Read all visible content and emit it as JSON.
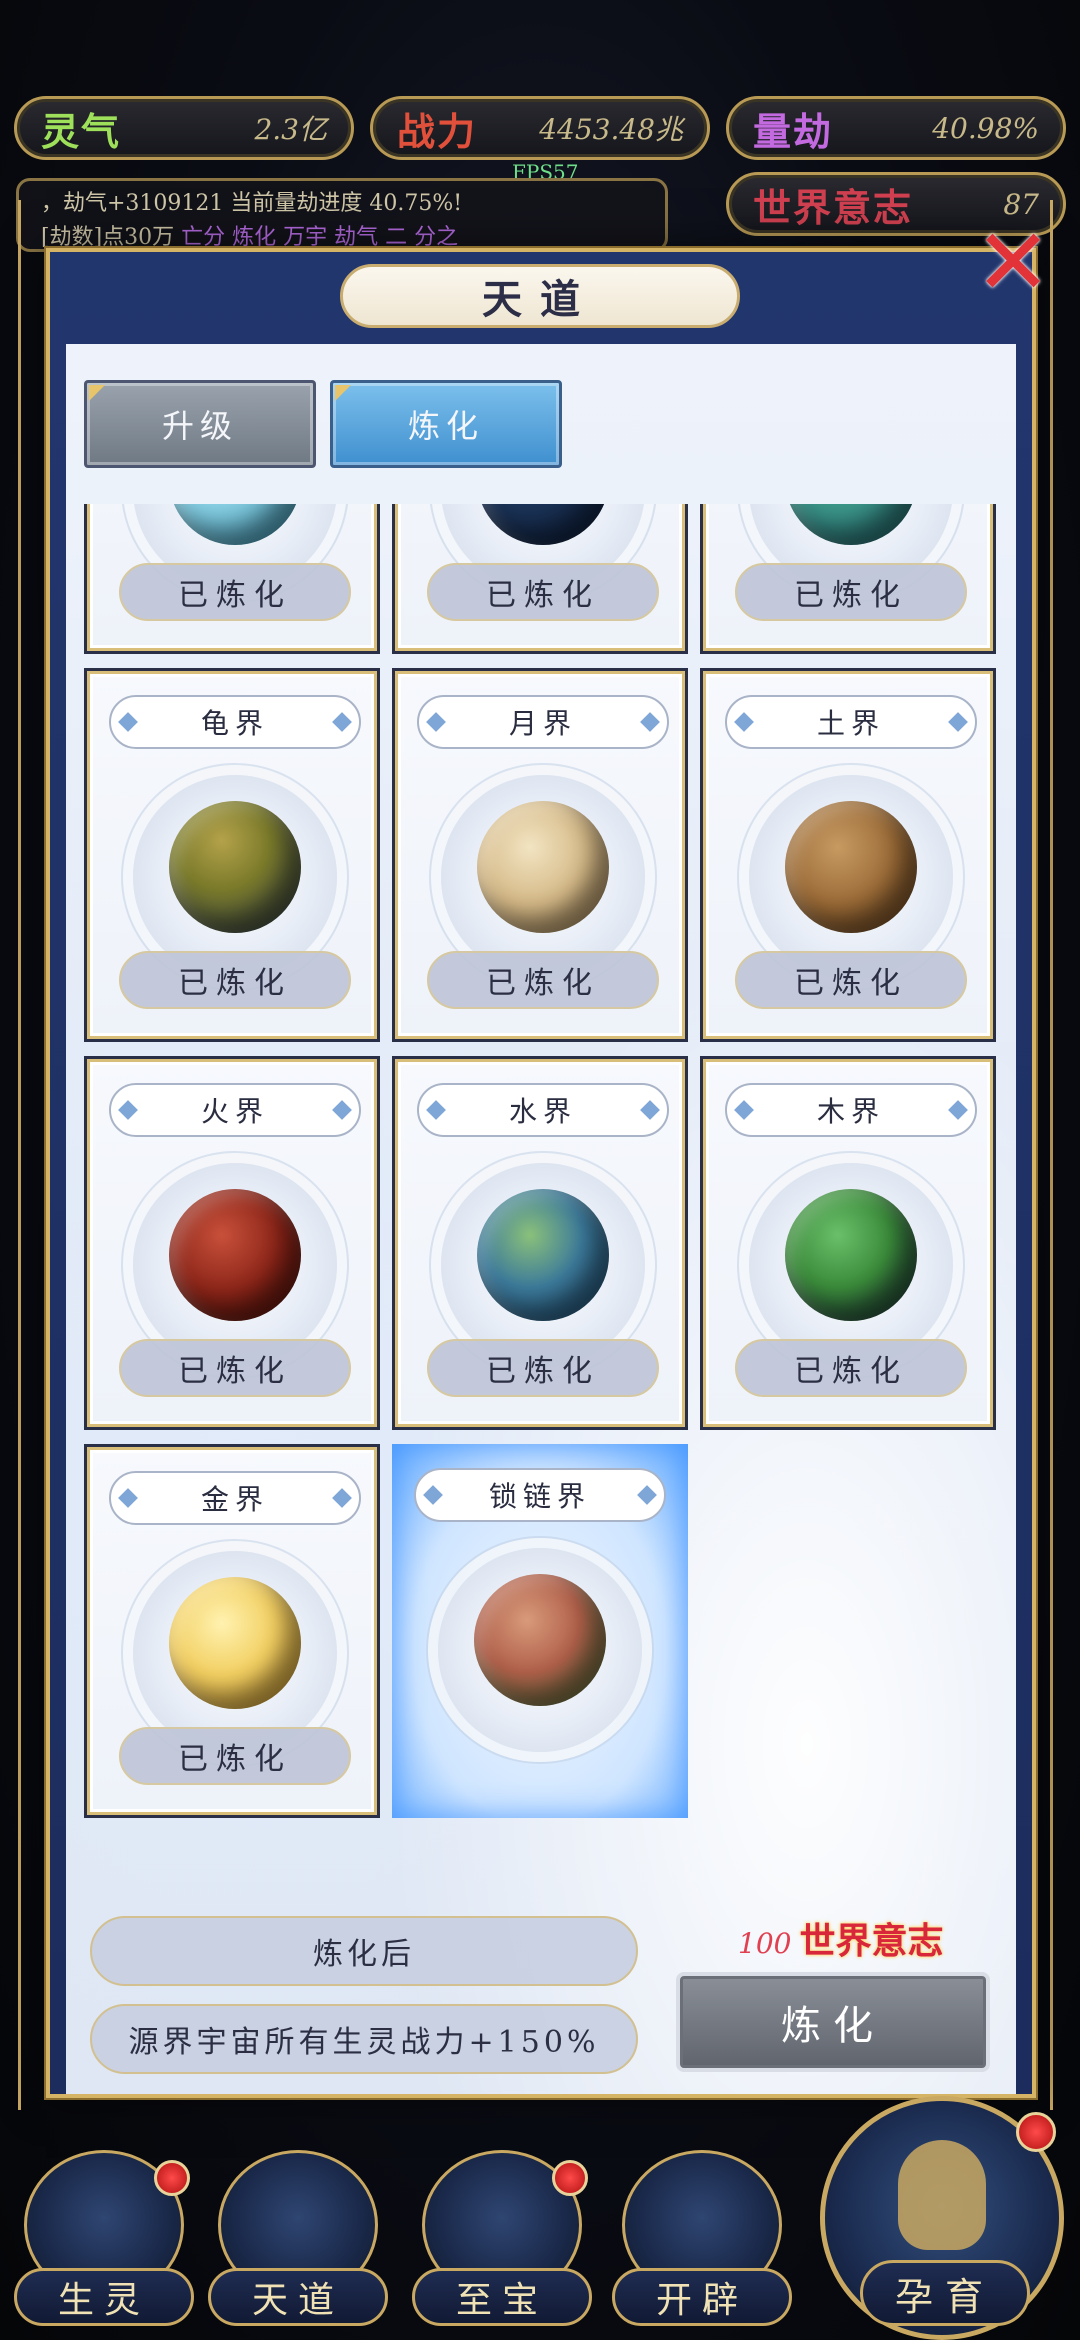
{
  "stats": [
    {
      "name": "灵气",
      "value": "2.3亿"
    },
    {
      "name": "战力",
      "value": "4453.48兆"
    },
    {
      "name": "量劫",
      "value": "40.98%"
    },
    {
      "name": "世界意志",
      "value": "87"
    }
  ],
  "fps": "FPS57",
  "log": {
    "line1": "，劫气+3109121 当前量劫进度 40.75%!",
    "line2_prefix": "[劫数]点30万",
    "line2_accent": "亡分 炼化 万宇 劫气 二 分之"
  },
  "modal": {
    "title": "天道",
    "close_icon": "close-x-icon",
    "tabs": [
      {
        "label": "升级",
        "active": false
      },
      {
        "label": "炼化",
        "active": true
      }
    ],
    "top_row_cards": [
      {
        "name": "",
        "status": "已炼化",
        "planet": "crystal"
      },
      {
        "name": "",
        "status": "已炼化",
        "planet": "ocean"
      },
      {
        "name": "",
        "status": "已炼化",
        "planet": "teal"
      }
    ],
    "cards": [
      {
        "name": "龟界",
        "status": "已炼化",
        "planet": "turtle"
      },
      {
        "name": "月界",
        "status": "已炼化",
        "planet": "moon"
      },
      {
        "name": "土界",
        "status": "已炼化",
        "planet": "earth"
      },
      {
        "name": "火界",
        "status": "已炼化",
        "planet": "fire"
      },
      {
        "name": "水界",
        "status": "已炼化",
        "planet": "water"
      },
      {
        "name": "木界",
        "status": "已炼化",
        "planet": "wood"
      },
      {
        "name": "金界",
        "status": "已炼化",
        "planet": "gold"
      },
      {
        "name": "锁链界",
        "status": "",
        "planet": "chain",
        "selected": true
      }
    ],
    "after_label": "炼化后",
    "effect": "源界宇宙所有生灵战力+150%",
    "cost": {
      "amount": "100",
      "unit": "世界意志"
    },
    "refine_button": "炼化"
  },
  "nav": [
    {
      "label": "生灵",
      "badge": true
    },
    {
      "label": "天道",
      "badge": false
    },
    {
      "label": "至宝",
      "badge": true
    },
    {
      "label": "开辟",
      "badge": false
    }
  ],
  "nav_main": {
    "label": "孕育",
    "badge": true
  },
  "colors": {
    "frame_gold": "#c9a862",
    "modal_blue": "#22366e",
    "tab_active": "#3f8fcf",
    "cost_red": "#d8263a"
  }
}
